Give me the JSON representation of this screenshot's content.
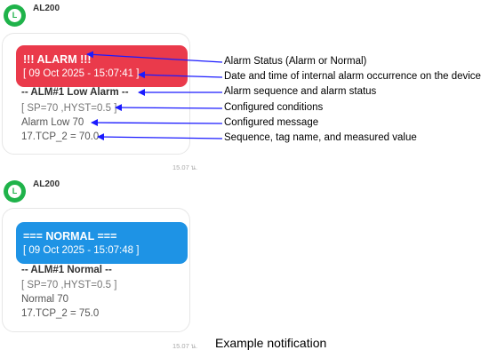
{
  "colors": {
    "alarm_banner": "#ea3a4b",
    "normal_banner": "#1e93e5",
    "avatar": "#1fb34a",
    "arrow": "#1a1aff"
  },
  "messages": [
    {
      "avatar_icon": "line-app-icon",
      "avatar_letter": "L",
      "sender": "AL200",
      "banner_title": "!!! ALARM !!!",
      "banner_date": "[ 09 Oct 2025 - 15:07:41 ]",
      "status_line": "-- ALM#1 Low Alarm --",
      "conditions": "[ SP=70 ,HYST=0.5 ]",
      "message": "Alarm Low 70",
      "value_line": "17.TCP_2 = 70.0",
      "timestamp": "15.07 น."
    },
    {
      "avatar_icon": "line-app-icon",
      "avatar_letter": "L",
      "sender": "AL200",
      "banner_title": "=== NORMAL ===",
      "banner_date": "[ 09 Oct 2025 - 15:07:48 ]",
      "status_line": "-- ALM#1 Normal --",
      "conditions": "[ SP=70 ,HYST=0.5 ]",
      "message": "Normal 70",
      "value_line": "17.TCP_2 = 75.0",
      "timestamp": "15.07 น."
    }
  ],
  "annotations": {
    "alarm_status": "Alarm Status (Alarm or Normal)",
    "date_time": "Date and time of internal alarm occurrence on the device",
    "sequence_status": "Alarm sequence and alarm status",
    "conditions": "Configured conditions",
    "message": "Configured message",
    "value": "Sequence, tag name, and measured value"
  },
  "caption": "Example notification"
}
